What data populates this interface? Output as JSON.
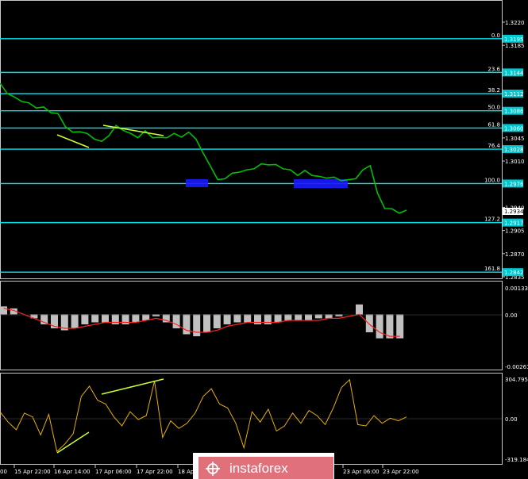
{
  "colors": {
    "background": "#000000",
    "price_line": "#00c000",
    "fib_line": "#00e5ee",
    "tag_bg": "#00c8d0",
    "highlight": "#1a1aff",
    "divergence": "#ccff33",
    "macd_hist": "#c0c0c0",
    "macd_signal": "#ff2020",
    "cci_line": "#e8b000",
    "watermark_bg": "#e0707a"
  },
  "price_axis": {
    "ticks": [
      "1.3220",
      "1.3185",
      "1.3045",
      "1.3010",
      "1.2940",
      "1.2905",
      "1.2870",
      "1.2835"
    ]
  },
  "fib_levels": [
    {
      "pct": "0.0",
      "tag": "1.3195"
    },
    {
      "pct": "23.6",
      "tag": "1.3144"
    },
    {
      "pct": "38.2",
      "tag": "1.3112"
    },
    {
      "pct": "50.0",
      "tag": "1.3086"
    },
    {
      "pct": "61.8",
      "tag": "1.3060"
    },
    {
      "pct": "76.4",
      "tag": "1.3028"
    },
    {
      "pct": "100.0",
      "tag": "1.2976"
    },
    {
      "pct": "127.2",
      "tag": "1.2917"
    },
    {
      "pct": "161.8",
      "tag": "1.2842"
    }
  ],
  "current_price": "1.2934",
  "macd_axis": {
    "top": "0.00133",
    "mid": "0.00",
    "bottom": "-0.00261"
  },
  "cci_axis": {
    "top": "304.7958",
    "mid": "0.00",
    "bottom": "-319.1849"
  },
  "time_axis": [
    "15 Apr 22:00",
    "16 Apr 14:00",
    "17 Apr 06:00",
    "17 Apr 22:00",
    "18 Apr",
    "23 Apr 06:00",
    "23 Apr 22:00"
  ],
  "time_axis_first_fragment": "00",
  "watermark": {
    "text": "instaforex"
  },
  "chart_data": {
    "type": "line",
    "price_series": [
      1.3126,
      1.3114,
      1.3105,
      1.3102,
      1.3096,
      1.3092,
      1.309,
      1.3085,
      1.308,
      1.3064,
      1.3052,
      1.3056,
      1.305,
      1.3045,
      1.3038,
      1.305,
      1.3062,
      1.3058,
      1.305,
      1.3047,
      1.3054,
      1.3047,
      1.3044,
      1.3047,
      1.305,
      1.3048,
      1.3052,
      1.3045,
      1.302,
      1.3004,
      1.298,
      1.2985,
      1.299,
      1.2995,
      1.2995,
      1.3,
      1.3004,
      1.3006,
      1.3003,
      1.3,
      1.2995,
      1.299,
      1.2994,
      1.299,
      1.2985,
      1.2986,
      1.2984,
      1.2982,
      1.298,
      1.2985,
      1.2995,
      1.3005,
      1.296,
      1.294,
      1.2936,
      1.2933,
      1.2934
    ],
    "macd_hist": [
      0.0004,
      0.0003,
      0.0,
      -0.0002,
      -0.0005,
      -0.0007,
      -0.0008,
      -0.0007,
      -0.0005,
      -0.0004,
      -0.0004,
      -0.0005,
      -0.0005,
      -0.0004,
      -0.0003,
      -0.0001,
      -0.0004,
      -0.0007,
      -0.001,
      -0.0011,
      -0.0009,
      -0.0007,
      -0.0005,
      -0.0004,
      -0.0004,
      -0.0005,
      -0.0005,
      -0.0004,
      -0.0003,
      -0.0003,
      -0.0003,
      -0.0002,
      -0.0002,
      -0.0001,
      0.0,
      0.0005,
      -0.0009,
      -0.0012,
      -0.0012,
      -0.0012
    ],
    "macd_signal": [
      0.0003,
      0.0002,
      0.0,
      -0.0002,
      -0.0004,
      -0.0006,
      -0.0007,
      -0.0007,
      -0.0006,
      -0.0005,
      -0.0004,
      -0.0004,
      -0.0004,
      -0.0004,
      -0.0003,
      -0.0002,
      -0.0003,
      -0.0005,
      -0.0008,
      -0.0009,
      -0.0009,
      -0.0008,
      -0.0006,
      -0.0005,
      -0.0004,
      -0.0004,
      -0.0004,
      -0.0004,
      -0.0003,
      -0.0003,
      -0.0003,
      -0.0003,
      -0.0002,
      -0.0002,
      -0.0001,
      0.0,
      -0.0005,
      -0.0009,
      -0.0011,
      -0.0011
    ],
    "cci_series": [
      50,
      -30,
      -90,
      40,
      10,
      -130,
      30,
      -260,
      -200,
      -120,
      170,
      250,
      140,
      110,
      10,
      -60,
      50,
      -10,
      20,
      290,
      -150,
      -20,
      -80,
      -40,
      40,
      170,
      230,
      110,
      80,
      -40,
      -230,
      50,
      -30,
      70,
      -100,
      -60,
      40,
      -40,
      60,
      20,
      -50,
      80,
      240,
      300,
      -50,
      -60,
      20,
      -40,
      0,
      -20,
      10
    ]
  }
}
